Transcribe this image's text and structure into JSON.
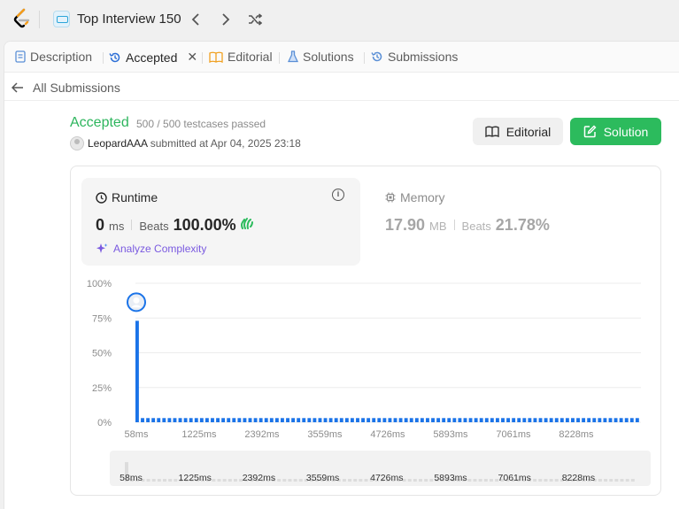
{
  "topbar": {
    "list_title": "Top Interview 150",
    "prev_icon": "chevron-left-icon",
    "next_icon": "chevron-right-icon",
    "shuffle_icon": "shuffle-icon"
  },
  "tabs": [
    {
      "label": "Description",
      "icon": "description-icon"
    },
    {
      "label": "Accepted",
      "icon": "history-icon",
      "active": true
    },
    {
      "label": "Editorial",
      "icon": "book-icon"
    },
    {
      "label": "Solutions",
      "icon": "flask-icon"
    },
    {
      "label": "Submissions",
      "icon": "history-icon"
    }
  ],
  "back": {
    "label": "All Submissions"
  },
  "submission": {
    "status": "Accepted",
    "testcases": "500 / 500 testcases passed",
    "user": "LeopardAAA",
    "submitted_text": "submitted at Apr 04, 2025 23:18"
  },
  "buttons": {
    "editorial": "Editorial",
    "solution": "Solution"
  },
  "runtime": {
    "title": "Runtime",
    "value": "0",
    "unit": "ms",
    "beats_label": "Beats",
    "beats_value": "100.00%",
    "analyze": "Analyze Complexity"
  },
  "memory": {
    "title": "Memory",
    "value": "17.90",
    "unit": "MB",
    "beats_label": "Beats",
    "beats_value": "21.78%"
  },
  "colors": {
    "accepted": "#2db55d",
    "bar": "#1a73e8",
    "solution_btn": "#2cbb5d",
    "analyze": "#7a5ae0"
  },
  "chart_data": {
    "type": "bar",
    "ylabel_ticks": [
      "0%",
      "25%",
      "50%",
      "75%",
      "100%"
    ],
    "ylim": [
      0,
      100
    ],
    "x_ticks": [
      "58ms",
      "1225ms",
      "2392ms",
      "3559ms",
      "4726ms",
      "5893ms",
      "7061ms",
      "8228ms"
    ],
    "values": [
      73,
      3,
      3,
      3,
      3,
      3,
      3,
      3,
      3,
      3,
      3,
      3,
      3,
      3,
      3,
      3,
      3,
      3,
      3,
      3,
      3,
      3,
      3,
      3,
      3,
      3,
      3,
      3,
      3,
      3,
      3,
      3,
      3,
      3,
      3,
      3,
      3,
      3,
      3,
      3,
      3,
      3,
      3,
      3,
      3,
      3,
      3,
      3,
      3,
      3,
      3,
      3,
      3,
      3,
      3,
      3,
      3,
      3,
      3,
      3,
      3,
      3,
      3,
      3,
      3,
      3,
      3,
      3,
      3,
      3,
      3,
      3,
      3,
      3,
      3,
      3,
      3,
      3,
      3,
      3,
      3,
      3,
      3,
      3,
      3,
      3,
      3,
      3,
      3,
      3,
      3,
      3,
      3,
      3
    ],
    "highlight_index": 0,
    "grid": true,
    "navigator_ticks": [
      "58ms",
      "1225ms",
      "2392ms",
      "3559ms",
      "4726ms",
      "5893ms",
      "7061ms",
      "8228ms"
    ]
  }
}
